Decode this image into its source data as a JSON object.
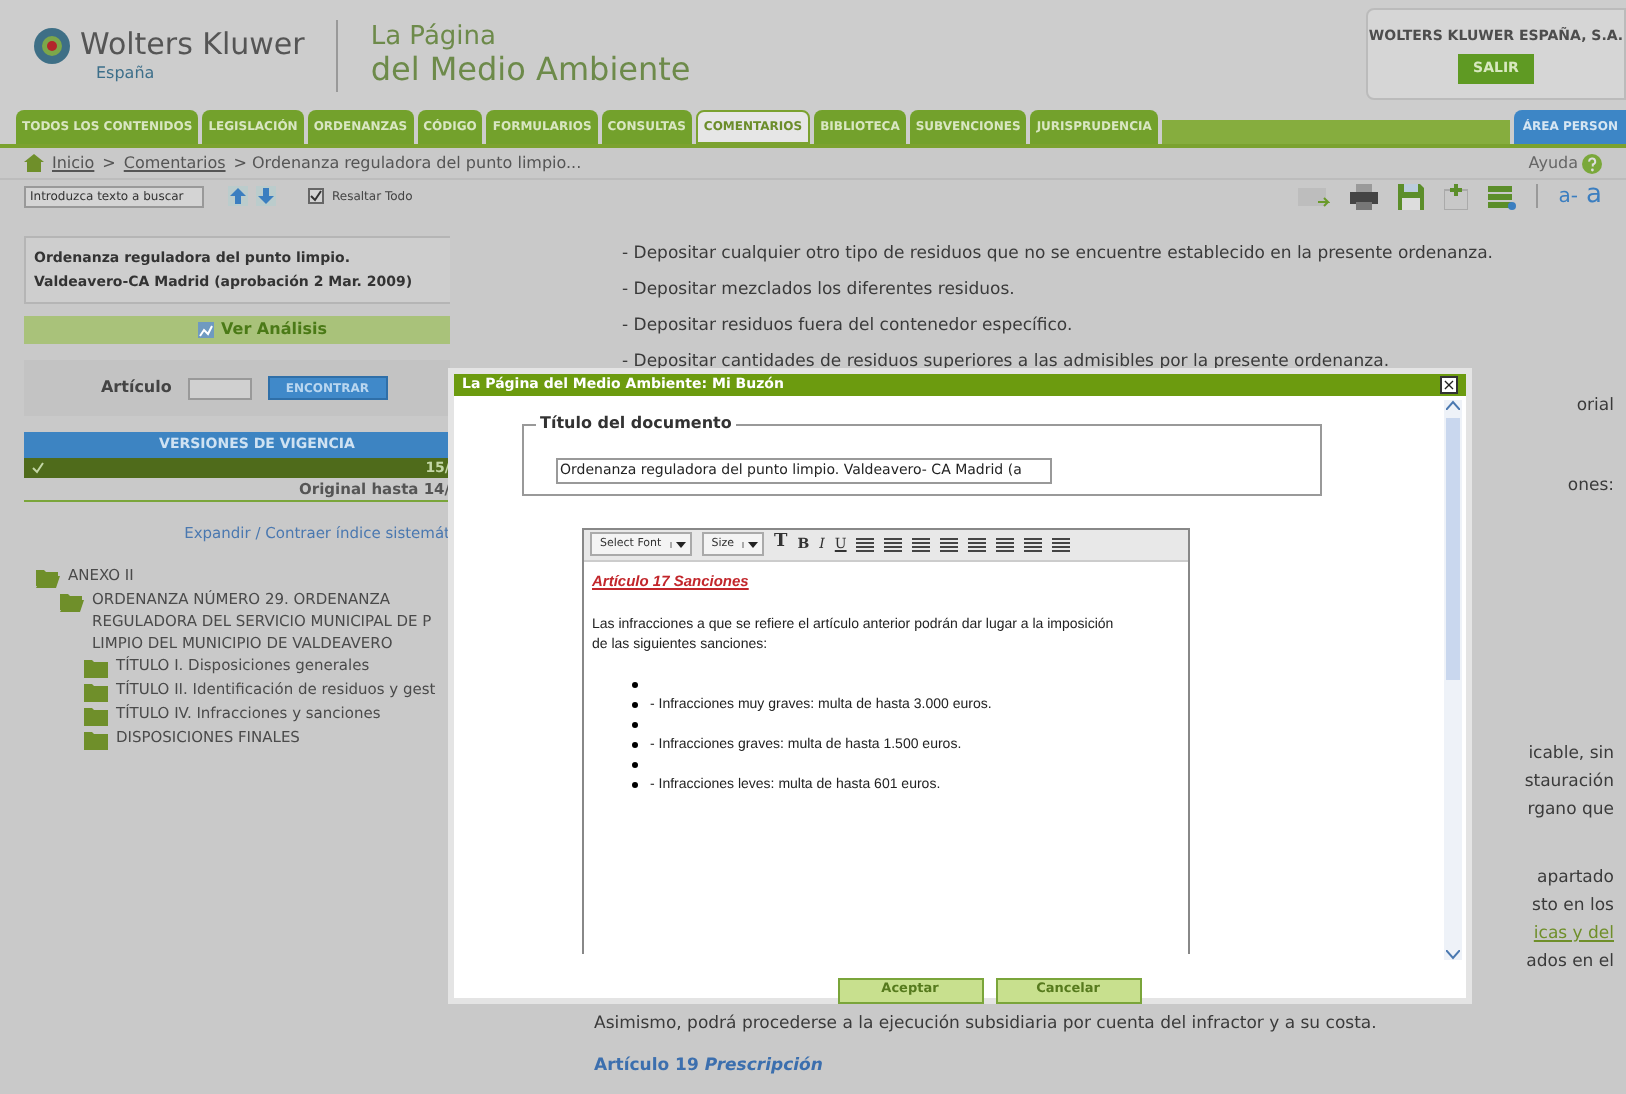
{
  "header": {
    "brand": "Wolters Kluwer",
    "country": "España",
    "site_title_1": "La Página",
    "site_title_2": "del Medio Ambiente",
    "account": "WOLTERS KLUWER ESPAÑA, S.A.",
    "logout": "SALIR"
  },
  "tabs": [
    {
      "label": "TODOS LOS CONTENIDOS",
      "selected": false
    },
    {
      "label": "LEGISLACIÓN",
      "selected": false
    },
    {
      "label": "ORDENANZAS",
      "selected": false
    },
    {
      "label": "CÓDIGO",
      "selected": false
    },
    {
      "label": "FORMULARIOS",
      "selected": false
    },
    {
      "label": "CONSULTAS",
      "selected": false
    },
    {
      "label": "COMENTARIOS",
      "selected": true
    },
    {
      "label": "BIBLIOTECA",
      "selected": false
    },
    {
      "label": "SUBVENCIONES",
      "selected": false
    },
    {
      "label": "JURISPRUDENCIA",
      "selected": false
    }
  ],
  "personal_area": "ÁREA PERSON",
  "breadcrumb": [
    {
      "label": "Inicio",
      "link": true
    },
    {
      "label": ">",
      "link": false
    },
    {
      "label": "Comentarios",
      "link": true
    },
    {
      "label": "> Ordenanza reguladora del punto limpio...",
      "link": false
    }
  ],
  "help": "Ayuda",
  "search": {
    "placeholder": "Introduzca texto a buscar",
    "highlight_label": "Resaltar Todo",
    "highlight_checked": true
  },
  "font_size_down": "a-",
  "font_size_up": "a",
  "sidebar": {
    "doc_title": "Ordenanza reguladora del punto limpio. Valdeavero-CA Madrid (aprobación 2 Mar. 2009)",
    "analysis": "Ver Análisis",
    "article_label": "Artículo",
    "find": "ENCONTRAR",
    "versions_title": "VERSIONES DE VIGENCIA",
    "versions": [
      {
        "label": "15/",
        "selected": true
      },
      {
        "label": "Original hasta 14/",
        "selected": false
      }
    ],
    "toggle_index": "Expandir / Contraer índice sistemát",
    "tree": [
      {
        "label": "ANEXO II",
        "expanded": true,
        "children": [
          {
            "label": "ORDENANZA NÚMERO 29. ORDENANZA REGULADORA DEL SERVICIO MUNICIPAL DE P LIMPIO DEL MUNICIPIO DE VALDEAVERO",
            "expanded": true,
            "children": [
              {
                "label": "TÍTULO I. Disposiciones generales",
                "expanded": false
              },
              {
                "label": "TÍTULO II. Identificación de residuos y gest",
                "expanded": false
              },
              {
                "label": "TÍTULO IV. Infracciones y sanciones",
                "expanded": false
              },
              {
                "label": "DISPOSICIONES FINALES",
                "expanded": false
              }
            ]
          }
        ]
      }
    ]
  },
  "content": {
    "lines": [
      "- Depositar cualquier otro tipo de residuos que no se encuentre establecido en la presente ordenanza.",
      "- Depositar mezclados los diferentes residuos.",
      "- Depositar residuos fuera del contenedor específico.",
      "- Depositar cantidades de residuos superiores a las admisibles por la presente ordenanza."
    ],
    "fragments": [
      [
        {
          "text": "orial",
          "link": false
        }
      ],
      [
        {
          "text": "ones:",
          "link": false
        }
      ],
      [
        {
          "text": "icable, sin",
          "link": false
        },
        {
          "text": "stauración",
          "link": false
        },
        {
          "text": "rgano que",
          "link": false
        }
      ],
      [
        {
          "text": "apartado",
          "link": false
        },
        {
          "text": "sto en los",
          "link": false
        },
        {
          "text": "icas y del",
          "link": true
        },
        {
          "text": "ados en el",
          "link": false
        }
      ]
    ],
    "closing": "Asimismo, podrá procederse a la ejecución subsidiaria por cuenta del infractor y a su costa.",
    "next_article": "Artículo 19",
    "next_article_title": "Prescripción"
  },
  "dialog": {
    "title": "La Página del Medio Ambiente: Mi Buzón",
    "close": "×",
    "doc_legend": "Título del documento",
    "doc_value": "Ordenanza reguladora del punto limpio. Valdeavero- CA Madrid (a",
    "toolbar": {
      "font": "Select Font",
      "size": "Size",
      "format": "T",
      "bold": "B",
      "italic": "I",
      "underline": "U"
    },
    "heading": "Artículo 17 Sanciones",
    "intro": "Las infracciones a que se refiere el artículo anterior podrán dar lugar a la imposición de las siguientes sanciones:",
    "items": [
      {
        "kind": "blank"
      },
      {
        "kind": "text",
        "text": "- Infracciones muy graves: multa de hasta 3.000 euros."
      },
      {
        "kind": "blank"
      },
      {
        "kind": "text",
        "text": "- Infracciones graves: multa de hasta 1.500 euros."
      },
      {
        "kind": "blank"
      },
      {
        "kind": "text",
        "text": "- Infracciones leves: multa de hasta 601 euros."
      }
    ],
    "ok": "Aceptar",
    "cancel": "Cancelar"
  }
}
